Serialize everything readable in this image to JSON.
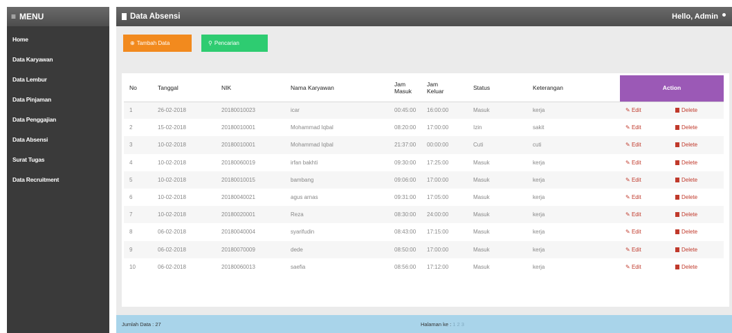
{
  "sidebar": {
    "title": "MENU",
    "items": [
      {
        "label": "Home"
      },
      {
        "label": "Data Karyawan"
      },
      {
        "label": "Data Lembur"
      },
      {
        "label": "Data Pinjaman"
      },
      {
        "label": "Data Penggajian"
      },
      {
        "label": "Data Absensi"
      },
      {
        "label": "Surat Tugas"
      },
      {
        "label": "Data Recruitment"
      }
    ]
  },
  "header": {
    "title": "Data Absensi",
    "greeting": "Hello, Admin"
  },
  "toolbar": {
    "add_label": "Tambah Data",
    "search_label": "Pencarian"
  },
  "table": {
    "columns": {
      "no": "No",
      "tanggal": "Tanggal",
      "nik": "NIK",
      "nama": "Nama Karyawan",
      "jam_masuk_1": "Jam",
      "jam_masuk_2": "Masuk",
      "jam_keluar_1": "Jam",
      "jam_keluar_2": "Keluar",
      "status": "Status",
      "keterangan": "Keterangan",
      "action": "Action"
    },
    "edit_label": "Edit",
    "delete_label": "Delete",
    "rows": [
      {
        "no": "1",
        "tanggal": "26-02-2018",
        "nik": "20180010023",
        "nama": "icar",
        "masuk": "00:45:00",
        "keluar": "16:00:00",
        "status": "Masuk",
        "keterangan": "kerja"
      },
      {
        "no": "2",
        "tanggal": "15-02-2018",
        "nik": "20180010001",
        "nama": "Mohammad Iqbal",
        "masuk": "08:20:00",
        "keluar": "17:00:00",
        "status": "Izin",
        "keterangan": "sakit"
      },
      {
        "no": "3",
        "tanggal": "10-02-2018",
        "nik": "20180010001",
        "nama": "Mohammad Iqbal",
        "masuk": "21:37:00",
        "keluar": "00:00:00",
        "status": "Cuti",
        "keterangan": "cuti"
      },
      {
        "no": "4",
        "tanggal": "10-02-2018",
        "nik": "20180060019",
        "nama": "irfan bakhti",
        "masuk": "09:30:00",
        "keluar": "17:25:00",
        "status": "Masuk",
        "keterangan": "kerja"
      },
      {
        "no": "5",
        "tanggal": "10-02-2018",
        "nik": "20180010015",
        "nama": "bambang",
        "masuk": "09:06:00",
        "keluar": "17:00:00",
        "status": "Masuk",
        "keterangan": "kerja"
      },
      {
        "no": "6",
        "tanggal": "10-02-2018",
        "nik": "20180040021",
        "nama": "agus arnas",
        "masuk": "09:31:00",
        "keluar": "17:05:00",
        "status": "Masuk",
        "keterangan": "kerja"
      },
      {
        "no": "7",
        "tanggal": "10-02-2018",
        "nik": "20180020001",
        "nama": "Reza",
        "masuk": "08:30:00",
        "keluar": "24:00:00",
        "status": "Masuk",
        "keterangan": "kerja"
      },
      {
        "no": "8",
        "tanggal": "06-02-2018",
        "nik": "20180040004",
        "nama": "syarifudin",
        "masuk": "08:43:00",
        "keluar": "17:15:00",
        "status": "Masuk",
        "keterangan": "kerja"
      },
      {
        "no": "9",
        "tanggal": "06-02-2018",
        "nik": "20180070009",
        "nama": "dede",
        "masuk": "08:50:00",
        "keluar": "17:00:00",
        "status": "Masuk",
        "keterangan": "kerja"
      },
      {
        "no": "10",
        "tanggal": "06-02-2018",
        "nik": "20180060013",
        "nama": "saefia",
        "masuk": "08:56:00",
        "keluar": "17:12:00",
        "status": "Masuk",
        "keterangan": "kerja"
      }
    ]
  },
  "footer": {
    "count_text": "Jumlah Data : 27",
    "page_label": "Halaman ke :",
    "pages": "1 2 3"
  },
  "colors": {
    "add_button": "#f28a1e",
    "search_button": "#2ecc71",
    "action_header": "#9b59b6",
    "footer_bar": "#a9d4ea",
    "delete": "#c0392b"
  }
}
